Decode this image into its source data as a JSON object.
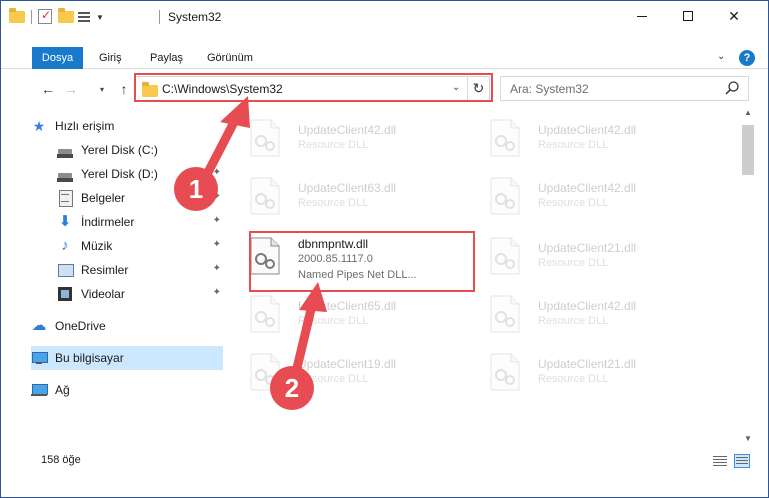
{
  "window": {
    "title": "System32",
    "colors": {
      "accent": "#1979ca",
      "highlight": "#e74c52",
      "selection": "#cce8ff"
    }
  },
  "quick_access_toolbar": {
    "icons": [
      "folder-icon",
      "properties-check-icon",
      "new-folder-icon",
      "properties-icon",
      "dropdown-icon"
    ]
  },
  "window_controls": {
    "minimize": "minimize-icon",
    "maximize": "maximize-icon",
    "close": "✕"
  },
  "ribbon": {
    "tabs": [
      {
        "label": "Dosya",
        "active": true
      },
      {
        "label": "Giriş"
      },
      {
        "label": "Paylaş"
      },
      {
        "label": "Görünüm"
      }
    ],
    "expand_glyph": "⌄",
    "help_glyph": "?"
  },
  "navigation": {
    "back_glyph": "←",
    "forward_glyph": "→",
    "recent_glyph": "▾",
    "up_glyph": "↑",
    "address_path": "C:\\Windows\\System32",
    "address_dropdown_glyph": "⌄",
    "refresh_glyph": "↻",
    "search_placeholder": "Ara: System32"
  },
  "sidebar": {
    "quick_access": {
      "label": "Hızlı erişim",
      "icon": "star-icon"
    },
    "items": [
      {
        "label": "Yerel Disk (C:)",
        "icon": "disk-icon",
        "pinned": false
      },
      {
        "label": "Yerel Disk (D:)",
        "icon": "disk-icon",
        "pinned": true
      },
      {
        "label": "Belgeler",
        "icon": "documents-icon",
        "pinned": true
      },
      {
        "label": "İndirmeler",
        "icon": "download-icon",
        "pinned": true
      },
      {
        "label": "Müzik",
        "icon": "music-icon",
        "pinned": true
      },
      {
        "label": "Resimler",
        "icon": "pictures-icon",
        "pinned": true
      },
      {
        "label": "Videolar",
        "icon": "videos-icon",
        "pinned": true
      }
    ],
    "onedrive": {
      "label": "OneDrive",
      "icon": "cloud-icon"
    },
    "this_pc": {
      "label": "Bu bilgisayar",
      "icon": "computer-icon",
      "selected": true
    },
    "network": {
      "label": "Ağ",
      "icon": "network-icon"
    },
    "pin_glyph": "📌"
  },
  "files": {
    "left_column": [
      {
        "name": "UpdateClient42.dll",
        "desc": "Resource DLL"
      },
      {
        "name": "UpdateClient63.dll",
        "desc": "Resource DLL"
      },
      {
        "name": "dbnmpntw.dll",
        "version": "2000.85.1117.0",
        "desc": "Named Pipes Net DLL..."
      },
      {
        "name": "UpdateClient65.dll",
        "desc": "Resource DLL"
      },
      {
        "name": "UpdateClient19.dll",
        "desc": "Resource DLL"
      }
    ],
    "right_column": [
      {
        "name": "UpdateClient42.dll",
        "desc": "Resource DLL"
      },
      {
        "name": "UpdateClient42.dll",
        "desc": "Resource DLL"
      },
      {
        "name": "UpdateClient21.dll",
        "desc": "Resource DLL"
      },
      {
        "name": "UpdateClient42.dll",
        "desc": "Resource DLL"
      },
      {
        "name": "UpdateClient21.dll",
        "desc": "Resource DLL"
      }
    ]
  },
  "annotations": {
    "step1": "1",
    "step2": "2"
  },
  "status": {
    "item_count": "158 öğe"
  }
}
